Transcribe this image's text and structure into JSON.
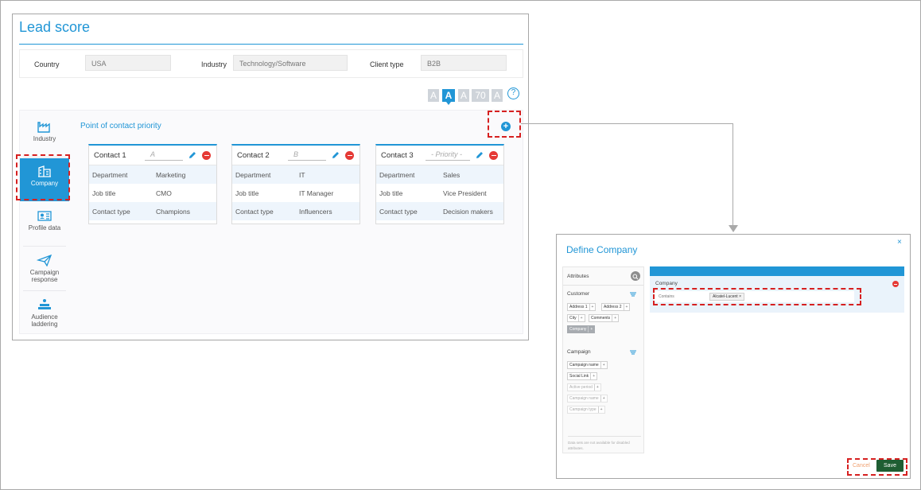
{
  "lead_score": {
    "title": "Lead score",
    "filters": [
      {
        "label": "Country",
        "value": "USA"
      },
      {
        "label": "Industry",
        "value": "Technology/Software"
      },
      {
        "label": "Client type",
        "value": "B2B"
      }
    ],
    "font_controls": [
      "A",
      "A",
      "A",
      "70",
      "A"
    ],
    "help_icon": "?",
    "sidebar": [
      {
        "label": "Industry",
        "icon": "factory-icon"
      },
      {
        "label": "Company",
        "icon": "building-icon",
        "active": true
      },
      {
        "label": "Profile data",
        "icon": "profile-card-icon"
      },
      {
        "label": "Campaign response",
        "icon": "paper-plane-icon"
      },
      {
        "label": "Audience laddering",
        "icon": "audience-stack-icon"
      }
    ],
    "section_title": "Point of contact priority",
    "add_icon": "+",
    "contacts": [
      {
        "name": "Contact 1",
        "priority": "A",
        "rows": [
          {
            "key": "Department",
            "value": "Marketing"
          },
          {
            "key": "Job title",
            "value": "CMO"
          },
          {
            "key": "Contact type",
            "value": "Champions"
          }
        ]
      },
      {
        "name": "Contact 2",
        "priority": "B",
        "rows": [
          {
            "key": "Department",
            "value": "IT"
          },
          {
            "key": "Job title",
            "value": "IT Manager"
          },
          {
            "key": "Contact type",
            "value": "Influencers"
          }
        ]
      },
      {
        "name": "Contact 3",
        "priority": "- Priority -",
        "rows": [
          {
            "key": "Department",
            "value": "Sales"
          },
          {
            "key": "Job title",
            "value": "Vice President"
          },
          {
            "key": "Contact type",
            "value": "Decision makers"
          }
        ]
      }
    ]
  },
  "dialog": {
    "title": "Define Company",
    "close_icon": "×",
    "attributes_title": "Attributes",
    "groups": [
      {
        "title": "Customer",
        "chips": [
          {
            "label": "Address 1"
          },
          {
            "label": "Address 2"
          },
          {
            "label": "City"
          },
          {
            "label": "Comments"
          },
          {
            "label": "Company",
            "selected": true
          }
        ]
      },
      {
        "title": "Campaign",
        "chips": [
          {
            "label": "Campaign name"
          },
          {
            "label": "Social Link"
          },
          {
            "label": "Active period",
            "disabled": true
          },
          {
            "label": "Campaign name",
            "disabled": true
          },
          {
            "label": "Campaign type",
            "disabled": true
          }
        ]
      }
    ],
    "note": "Data sets are not available for disabled attributes.",
    "condition": {
      "field": "Company",
      "operator": "Contains",
      "value": "Alcatel-Lucent",
      "value_remove": "×"
    },
    "cancel_label": "Cancel",
    "save_label": "Save"
  },
  "colors": {
    "accent": "#2196d6",
    "danger": "#e53935",
    "save": "#1f5e33",
    "highlight": "#d62020"
  }
}
